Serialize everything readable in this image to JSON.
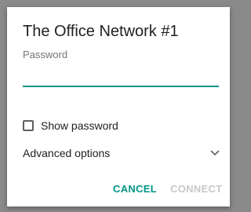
{
  "dialog": {
    "title": "The Office Network #1",
    "password_label": "Password",
    "password_value": "",
    "show_password_label": "Show password",
    "show_password_checked": false,
    "advanced_options_label": "Advanced options",
    "cancel_label": "CANCEL",
    "connect_label": "CONNECT",
    "connect_enabled": false
  },
  "colors": {
    "accent": "#009688",
    "disabled_text": "#c8c8c8",
    "primary_text": "#212121",
    "secondary_text": "#757575"
  },
  "icons": {
    "advanced_toggle": "chevron-down-icon"
  }
}
